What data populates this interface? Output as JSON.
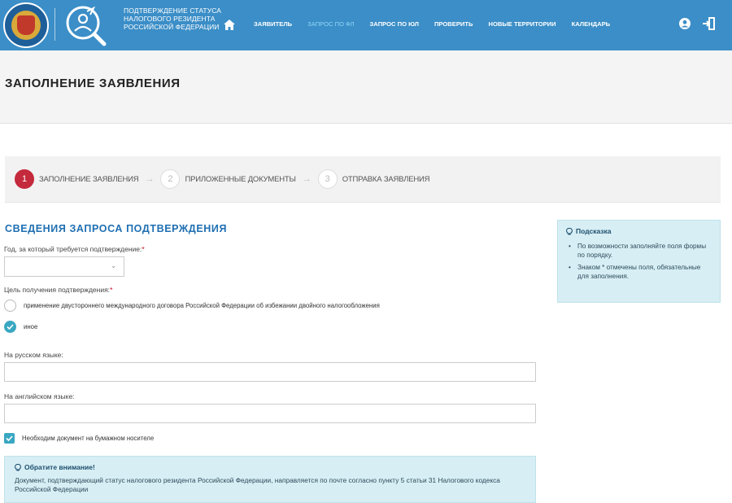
{
  "header": {
    "brand_lines": [
      "ПОДТВЕРЖДЕНИЕ СТАТУСА",
      "НАЛОГОВОГО РЕЗИДЕНТА",
      "РОССИЙСКОЙ ФЕДЕРАЦИИ"
    ],
    "nav": [
      {
        "label": "ЗАЯВИТЕЛЬ",
        "active": false
      },
      {
        "label": "ЗАПРОС ПО ФЛ",
        "active": true
      },
      {
        "label": "ЗАПРОС ПО ЮЛ",
        "active": false
      },
      {
        "label": "ПРОВЕРИТЬ",
        "active": false
      },
      {
        "label": "НОВЫЕ ТЕРРИТОРИИ",
        "active": false
      },
      {
        "label": "КАЛЕНДАРЬ",
        "active": false
      }
    ],
    "colors": {
      "bar": "#3b8ec7",
      "active_nav": "#8fd6f5"
    }
  },
  "page": {
    "title": "ЗАПОЛНЕНИЕ ЗАЯВЛЕНИЯ"
  },
  "steps": [
    {
      "num": "1",
      "label": "ЗАПОЛНЕНИЕ ЗАЯВЛЕНИЯ",
      "active": true
    },
    {
      "num": "2",
      "label": "ПРИЛОЖЕННЫЕ ДОКУМЕНТЫ",
      "active": false
    },
    {
      "num": "3",
      "label": "ОТПРАВКА ЗАЯВЛЕНИЯ",
      "active": false
    }
  ],
  "form": {
    "section_title": "СВЕДЕНИЯ ЗАПРОСА ПОДТВЕРЖДЕНИЯ",
    "year_label": "Год, за который требуется подтверждение:",
    "year_value": "",
    "purpose_label": "Цель получения подтверждения:",
    "required_mark": "*",
    "purpose_options": [
      {
        "label": "применение двустороннего международного договора Российской Федерации об избежании двойного налогообложения",
        "checked": false
      },
      {
        "label": "иное",
        "checked": true
      }
    ],
    "ru_label": "На русском языке:",
    "ru_value": "",
    "en_label": "На английском языке:",
    "en_value": "",
    "paper_label": "Необходим документ на бумажном носителе",
    "paper_checked": true
  },
  "notice": {
    "title": "Обратите внимание!",
    "text": "Документ, подтверждающий статус налогового резидента Российской Федерации, направляется по почте согласно пункту 5 статьи 31 Налогового кодекса Российской Федерации"
  },
  "hint": {
    "title": "Подсказка",
    "items": [
      "По возможности заполняйте поля формы по порядку.",
      "Знаком * отмечены поля, обязательные для заполнения."
    ]
  },
  "colors": {
    "accent": "#1f6fb2",
    "step_active": "#c4293c",
    "check": "#3aa7c2",
    "info_bg": "#d7eef4"
  }
}
